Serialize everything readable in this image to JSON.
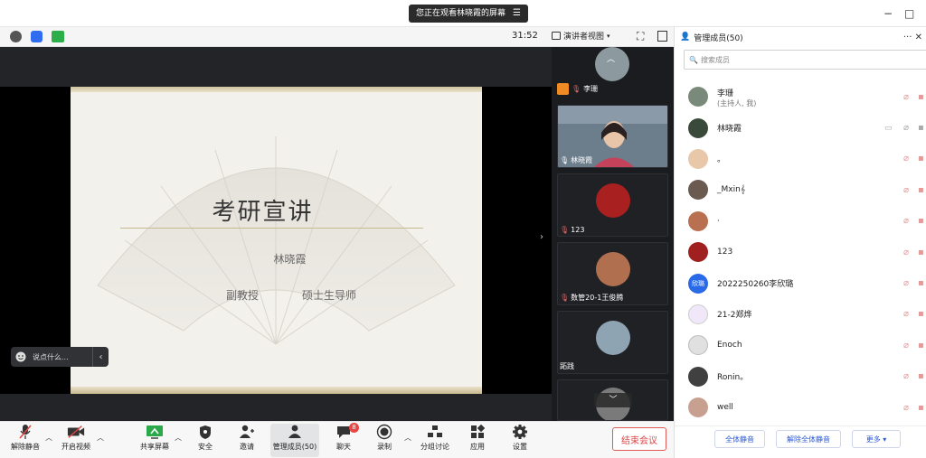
{
  "titlebar": {
    "share_notice": "您正在观看林晓霞的屏幕",
    "share_icon": "list-icon",
    "minimize": "−",
    "maximize": "□"
  },
  "toolbar": {
    "timer": "31:52",
    "view_label": "演讲者视图",
    "info_icon": "info-icon",
    "shield_icon": "shield-icon",
    "signal_icon": "signal-icon"
  },
  "slide": {
    "title": "考研宣讲",
    "name": "林晓霞",
    "role": "副教授",
    "degree": "硕士生导师"
  },
  "chat_input": {
    "placeholder": "说点什么..."
  },
  "video_strip": [
    {
      "label": "李珊",
      "host": true
    },
    {
      "label": "林晓霞",
      "host": false
    },
    {
      "label": "123",
      "host": false
    },
    {
      "label": "数管20-1王俊腾",
      "host": false
    },
    {
      "label": "跖践",
      "host": false
    }
  ],
  "panel": {
    "title": "管理成员(50)",
    "search_placeholder": "搜索成员",
    "members": [
      {
        "name": "李珊",
        "sub": "(主持人, 我)",
        "color": "#7a8a7a"
      },
      {
        "name": "林晓霞",
        "sub": "",
        "color": "#3a4a3a"
      },
      {
        "name": "。",
        "sub": "",
        "color": "#e8c8a8"
      },
      {
        "name": "_Mxin𝄞",
        "sub": "",
        "color": "#6a5a50"
      },
      {
        "name": "·",
        "sub": "",
        "color": "#b87050"
      },
      {
        "name": "123",
        "sub": "",
        "color": "#a02020"
      },
      {
        "name": "2022250260李欣璐",
        "sub": "",
        "color": "#2a6ae8",
        "initials": "欣璐"
      },
      {
        "name": "21-2郑烨",
        "sub": "",
        "color": "#f0e8f8"
      },
      {
        "name": "Enoch",
        "sub": "",
        "color": "#e0e0e0"
      },
      {
        "name": "Ronin。",
        "sub": "",
        "color": "#404040"
      },
      {
        "name": "well",
        "sub": "",
        "color": "#c8a090"
      }
    ],
    "mute_all": "全体静音",
    "unmute_all": "解除全体静音",
    "more": "更多 ▾"
  },
  "bottombar": {
    "unmute": "解除静音",
    "start_video": "开启视频",
    "share_screen": "共享屏幕",
    "security": "安全",
    "invite": "邀请",
    "manage_members": "管理成员(50)",
    "chat": "聊天",
    "chat_badge": "8",
    "record": "录制",
    "breakout": "分组讨论",
    "apps": "应用",
    "settings": "设置",
    "end_meeting": "结束会议"
  },
  "colors": {
    "accent_blue": "#2b5ad6",
    "end_red": "#e04444",
    "muted_red": "#e59a9a"
  }
}
